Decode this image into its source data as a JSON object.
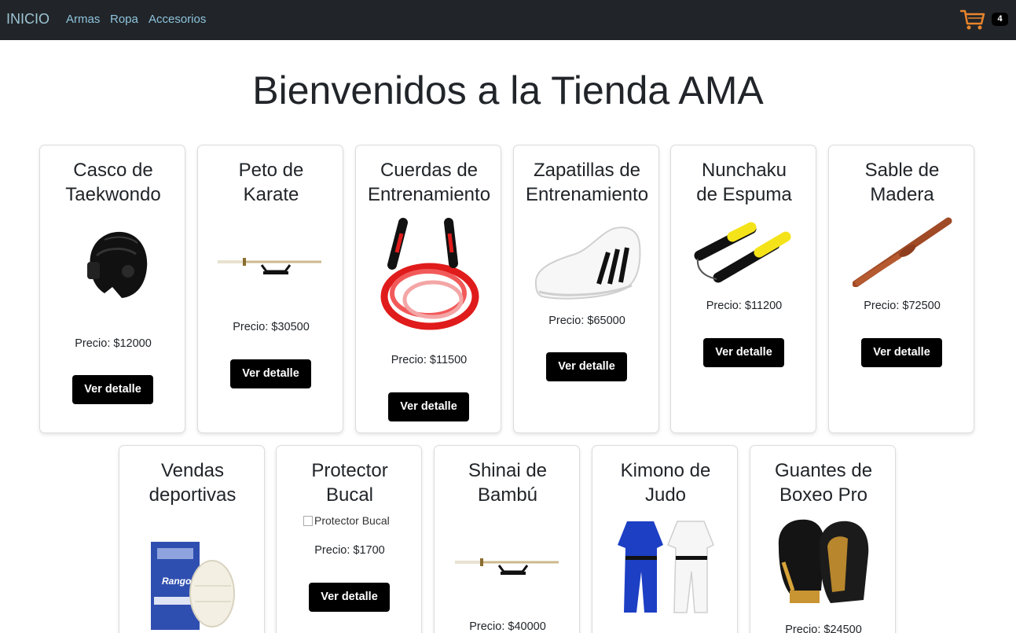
{
  "nav": {
    "brand": "INICIO",
    "links": [
      "Armas",
      "Ropa",
      "Accesorios"
    ],
    "cart_icon": "shopping-cart-icon",
    "cart_count": "4"
  },
  "colors": {
    "navbar": "#212529",
    "cart": "#e8842c",
    "button": "#000000",
    "nav_link": "#8ec3dc"
  },
  "page": {
    "title": "Bienvenidos a la Tienda AMA"
  },
  "button_label": "Ver detalle",
  "products": [
    {
      "title_line1": "Casco de",
      "title_line2": "Taekwondo",
      "price": "Precio: $12000"
    },
    {
      "title_line1": "Peto de",
      "title_line2": "Karate",
      "price": "Precio: $30500"
    },
    {
      "title_line1": "Cuerdas de",
      "title_line2": "Entrenamiento",
      "price": "Precio: $11500"
    },
    {
      "title_line1": "Zapatillas de",
      "title_line2": "Entrenamiento",
      "price": "Precio: $65000"
    },
    {
      "title_line1": "Nunchaku",
      "title_line2": "de Espuma",
      "price": "Precio: $11200"
    },
    {
      "title_line1": "Sable de",
      "title_line2": "Madera",
      "price": "Precio: $72500"
    },
    {
      "title_line1": "Vendas",
      "title_line2": "deportivas",
      "price": ""
    },
    {
      "title_line1": "Protector",
      "title_line2": "Bucal",
      "price": "Precio: $1700",
      "image_alt": "Protector Bucal"
    },
    {
      "title_line1": "Shinai de",
      "title_line2": "Bambú",
      "price": "Precio: $40000"
    },
    {
      "title_line1": "Kimono de",
      "title_line2": "Judo",
      "price": ""
    },
    {
      "title_line1": "Guantes de",
      "title_line2": "Boxeo Pro",
      "price": "Precio: $24500"
    }
  ]
}
